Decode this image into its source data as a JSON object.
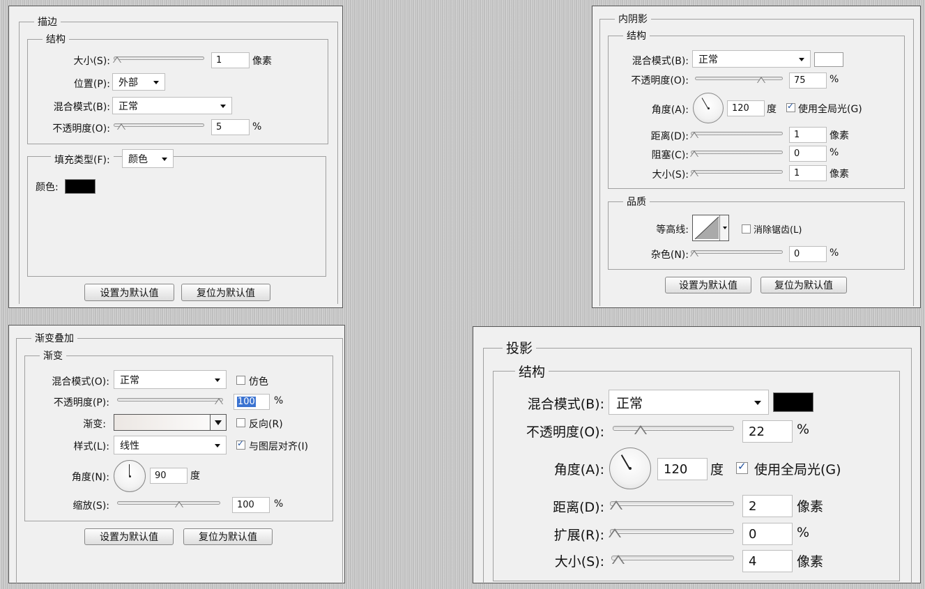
{
  "stroke": {
    "title": "描边",
    "structure_title": "结构",
    "size_label": "大小(S):",
    "size_value": "1",
    "size_unit": "像素",
    "size_level": 0,
    "position_label": "位置(P):",
    "position_value": "外部",
    "blend_label": "混合模式(B):",
    "blend_value": "正常",
    "opacity_label": "不透明度(O):",
    "opacity_value": "5",
    "opacity_unit": "%",
    "opacity_level": 0.05,
    "fill_type_label": "填充类型(F):",
    "fill_type_value": "颜色",
    "color_label": "颜色:",
    "color_hex": "#000000",
    "btn_make_default": "设置为默认值",
    "btn_reset_default": "复位为默认值"
  },
  "inner_shadow": {
    "title": "内阴影",
    "structure_title": "结构",
    "blend_label": "混合模式(B):",
    "blend_value": "正常",
    "color_hex": "#ffffff",
    "opacity_label": "不透明度(O):",
    "opacity_value": "75",
    "opacity_unit": "%",
    "opacity_level": 0.75,
    "angle_label": "角度(A):",
    "angle_value": "120",
    "angle_unit": "度",
    "global_light_label": "使用全局光(G)",
    "global_light_checked": true,
    "distance_label": "距离(D):",
    "distance_value": "1",
    "distance_unit": "像素",
    "choke_label": "阻塞(C):",
    "choke_value": "0",
    "choke_unit": "%",
    "size_label": "大小(S):",
    "size_value": "1",
    "size_unit": "像素",
    "quality_title": "品质",
    "contour_label": "等高线:",
    "antialias_label": "消除锯齿(L)",
    "antialias_checked": false,
    "noise_label": "杂色(N):",
    "noise_value": "0",
    "noise_unit": "%",
    "btn_make_default": "设置为默认值",
    "btn_reset_default": "复位为默认值"
  },
  "gradient_overlay": {
    "title": "渐变叠加",
    "gradient_title": "渐变",
    "blend_label": "混合模式(O):",
    "blend_value": "正常",
    "dither_label": "仿色",
    "dither_checked": false,
    "opacity_label": "不透明度(P):",
    "opacity_value": "100",
    "opacity_unit": "%",
    "opacity_level": 1.0,
    "gradient_label": "渐变:",
    "reverse_label": "反向(R)",
    "reverse_checked": false,
    "style_label": "样式(L):",
    "style_value": "线性",
    "align_label": "与图层对齐(I)",
    "align_checked": true,
    "angle_label": "角度(N):",
    "angle_value": "90",
    "angle_unit": "度",
    "scale_label": "缩放(S):",
    "scale_value": "100",
    "scale_unit": "%",
    "scale_level": 0.6,
    "btn_make_default": "设置为默认值",
    "btn_reset_default": "复位为默认值"
  },
  "drop_shadow": {
    "title": "投影",
    "structure_title": "结构",
    "blend_label": "混合模式(B):",
    "blend_value": "正常",
    "color_hex": "#000000",
    "opacity_label": "不透明度(O):",
    "opacity_value": "22",
    "opacity_unit": "%",
    "opacity_level": 0.22,
    "angle_label": "角度(A):",
    "angle_value": "120",
    "angle_unit": "度",
    "global_light_label": "使用全局光(G)",
    "global_light_checked": true,
    "distance_label": "距离(D):",
    "distance_value": "2",
    "distance_unit": "像素",
    "spread_label": "扩展(R):",
    "spread_value": "0",
    "spread_unit": "%",
    "size_label": "大小(S):",
    "size_value": "4",
    "size_unit": "像素"
  }
}
